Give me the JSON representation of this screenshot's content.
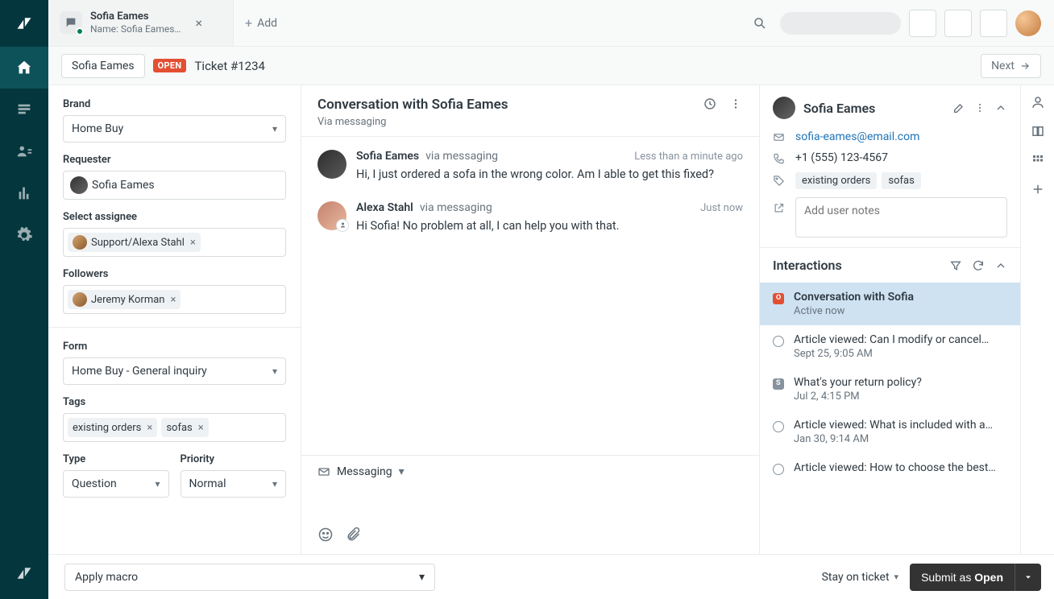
{
  "leftnav": {
    "items": [
      "home",
      "views",
      "customers",
      "reports",
      "settings"
    ]
  },
  "tab": {
    "title": "Sofia Eames",
    "subtitle": "Name: Sofia Eames…"
  },
  "add_tab_label": "Add",
  "subheader": {
    "breadcrumb": "Sofia Eames",
    "status": "OPEN",
    "ticket": "Ticket #1234",
    "next": "Next"
  },
  "sidebar": {
    "brand_label": "Brand",
    "brand_value": "Home Buy",
    "requester_label": "Requester",
    "requester_value": "Sofia Eames",
    "assignee_label": "Select assignee",
    "assignee_value": "Support/Alexa Stahl",
    "followers_label": "Followers",
    "followers": [
      "Jeremy Korman"
    ],
    "form_label": "Form",
    "form_value": "Home Buy - General inquiry",
    "tags_label": "Tags",
    "tags": [
      "existing orders",
      "sofas"
    ],
    "type_label": "Type",
    "type_value": "Question",
    "priority_label": "Priority",
    "priority_value": "Normal"
  },
  "conversation": {
    "title": "Conversation with Sofia Eames",
    "via": "Via messaging",
    "messages": [
      {
        "author": "Sofia Eames",
        "via": "via messaging",
        "time": "Less than a minute ago",
        "text": "Hi, I just ordered a sofa in the wrong color. Am I able to get this fixed?",
        "agent": false
      },
      {
        "author": "Alexa Stahl",
        "via": "via messaging",
        "time": "Just now",
        "text": "Hi Sofia! No problem at all, I can help you with that.",
        "agent": true
      }
    ],
    "composer_channel": "Messaging"
  },
  "customer": {
    "name": "Sofia Eames",
    "email": "sofia-eames@email.com",
    "phone": "+1 (555) 123-4567",
    "tags": [
      "existing orders",
      "sofas"
    ],
    "notes_placeholder": "Add user notes"
  },
  "interactions": {
    "title": "Interactions",
    "items": [
      {
        "marker": "open",
        "title": "Conversation with Sofia",
        "sub": "Active now",
        "active": true
      },
      {
        "marker": "circle",
        "title": "Article viewed: Can I modify or cancel…",
        "sub": "Sept 25, 9:05 AM"
      },
      {
        "marker": "solved",
        "title": "What's your return policy?",
        "sub": "Jul 2, 4:15 PM"
      },
      {
        "marker": "circle",
        "title": "Article viewed: What is included with a…",
        "sub": "Jan 30, 9:14 AM"
      },
      {
        "marker": "circle",
        "title": "Article viewed: How to choose the best…",
        "sub": ""
      }
    ]
  },
  "footer": {
    "macro": "Apply macro",
    "stay": "Stay on ticket",
    "submit_prefix": "Submit as ",
    "submit_status": "Open"
  }
}
